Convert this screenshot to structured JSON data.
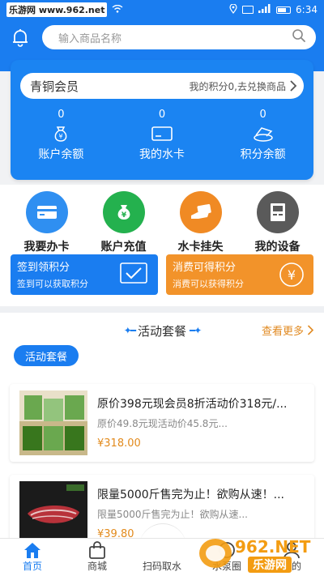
{
  "status_bar": {
    "watermark": "乐游网 www.962.net",
    "time": "6:34"
  },
  "header": {
    "search_placeholder": "输入商品名称"
  },
  "member": {
    "level": "青铜会员",
    "points_text": "我的积分0,去兑换商品",
    "stats": [
      {
        "value": "0",
        "label": "账户余额",
        "icon": "money-bag-icon"
      },
      {
        "value": "0",
        "label": "我的水卡",
        "icon": "card-icon"
      },
      {
        "value": "0",
        "label": "积分余额",
        "icon": "coins-icon"
      }
    ]
  },
  "quick_actions": [
    {
      "label": "我要办卡",
      "color": "#2f8ff1",
      "icon": "card-icon"
    },
    {
      "label": "账户充值",
      "color": "#24b14e",
      "icon": "money-bag-icon"
    },
    {
      "label": "水卡挂失",
      "color": "#f08a24",
      "icon": "hand-card-icon"
    },
    {
      "label": "我的设备",
      "color": "#5a5a5a",
      "icon": "device-icon"
    }
  ],
  "promos": [
    {
      "title": "签到领积分",
      "subtitle": "签到可以获取积分",
      "color": "#1a7df0",
      "icon": "checkin-icon"
    },
    {
      "title": "消费可得积分",
      "subtitle": "消费可以获得积分",
      "color": "#f2932a",
      "icon": "yen-icon"
    }
  ],
  "activity": {
    "title": "活动套餐",
    "more": "查看更多",
    "chip": "活动套餐",
    "products": [
      {
        "title": "原价398元现会员8折活动价318元/...",
        "desc": "原价49.8元现活动价45.8元...",
        "price": "¥318.00"
      },
      {
        "title": "限量5000斤售完为止！欲购从速！...",
        "desc": "限量5000斤售完为止！欲购从速...",
        "price": "¥39.80"
      }
    ]
  },
  "nav": [
    {
      "label": "首页",
      "icon": "home-icon",
      "active": true
    },
    {
      "label": "商城",
      "icon": "shop-bag-icon",
      "active": false
    },
    {
      "label": "扫码取水",
      "icon": "scan-icon",
      "active": false
    },
    {
      "label": "水泵圈",
      "icon": "circle-icon",
      "active": false
    },
    {
      "label": "我的",
      "icon": "user-icon",
      "active": false
    }
  ],
  "watermark": {
    "brand": "962.NET",
    "caption": "乐游网"
  },
  "colors": {
    "primary": "#1a7df0",
    "price": "#e28a1c"
  }
}
